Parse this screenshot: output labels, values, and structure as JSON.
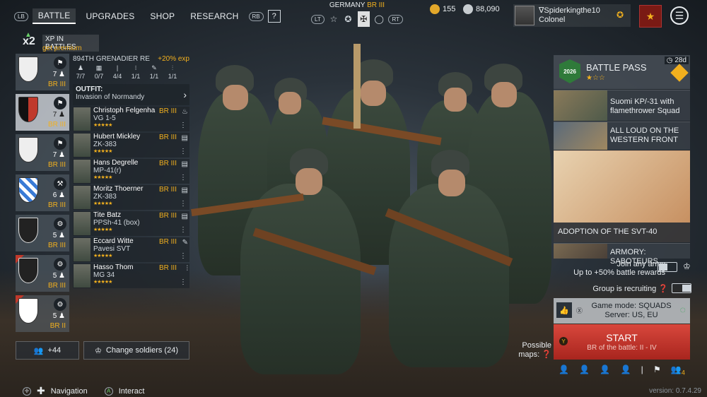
{
  "nav": {
    "lb": "LB",
    "rb": "RB",
    "tabs": [
      "BATTLE",
      "UPGRADES",
      "SHOP",
      "RESEARCH"
    ],
    "help": "?"
  },
  "army": {
    "name": "GERMANY",
    "br": "BR III",
    "lt": "LT",
    "rt": "RT"
  },
  "currency": {
    "gold": "155",
    "silver": "88,090"
  },
  "profile": {
    "name": "∇Spiderkingthe10",
    "rank": "Colonel"
  },
  "xp": {
    "mult": "x2",
    "label": "XP IN BATTLES",
    "premium": "get premium"
  },
  "squads": [
    {
      "count": "7",
      "br": "BR III",
      "type": "⚑"
    },
    {
      "count": "7",
      "br": "BR III",
      "type": "⚑"
    },
    {
      "count": "7",
      "br": "BR III",
      "type": "⚑"
    },
    {
      "count": "6",
      "br": "BR III",
      "type": "⚒"
    },
    {
      "count": "5",
      "br": "BR III",
      "type": "⚙"
    },
    {
      "count": "5",
      "br": "BR III",
      "type": "⚙"
    },
    {
      "count": "5",
      "br": "BR II",
      "type": "⚙"
    }
  ],
  "squad_detail": {
    "name": "894TH GRENADIER RE",
    "exp": "+20% exp",
    "stats": [
      "7/7",
      "0/7",
      "4/4",
      "1/1",
      "1/1",
      "1/1"
    ],
    "outfit_title": "OUTFIT:",
    "outfit_sub": "Invasion of Normandy"
  },
  "soldiers": [
    {
      "name": "Christoph Felgenha",
      "weapon": "VG 1-5",
      "br": "BR III"
    },
    {
      "name": "Hubert Mickley",
      "weapon": "ZK-383",
      "br": "BR III"
    },
    {
      "name": "Hans Degrelle",
      "weapon": "MP-41(r)",
      "br": "BR III"
    },
    {
      "name": "Moritz Thoerner",
      "weapon": "ZK-383",
      "br": "BR III"
    },
    {
      "name": "Tite Batz",
      "weapon": "PPSh-41 (box)",
      "br": "BR III"
    },
    {
      "name": "Eccard Witte",
      "weapon": "Pavesi SVT",
      "br": "BR III"
    },
    {
      "name": "Hasso Thom",
      "weapon": "MG 34",
      "br": "BR III"
    }
  ],
  "bottom": {
    "friends": "+44",
    "change": "Change soldiers (24)"
  },
  "hints": {
    "nav": "Navigation",
    "interact": "Interact"
  },
  "battlepass": {
    "title": "BATTLE PASS",
    "days": "28d",
    "logo": "2026"
  },
  "promos": [
    {
      "text": "Suomi KP/-31 with flamethrower Squad"
    },
    {
      "text": "ALL LOUD ON THE WESTERN FRONT"
    },
    {
      "text": "ADOPTION OF THE SVT-40"
    },
    {
      "text": "ARMORY: SABOTEURS"
    }
  ],
  "options": {
    "join": "Join any army",
    "join_sub": "Up to +50% battle rewards",
    "recruiting": "Group is recruiting"
  },
  "gamemode": {
    "mode": "Game mode: SQUADS",
    "server": "Server: US, EU"
  },
  "start": {
    "title": "START",
    "sub": "BR of the battle: II - IV"
  },
  "maps": "Possible maps:",
  "party_count": "4",
  "version": "version: 0.7.4.29"
}
